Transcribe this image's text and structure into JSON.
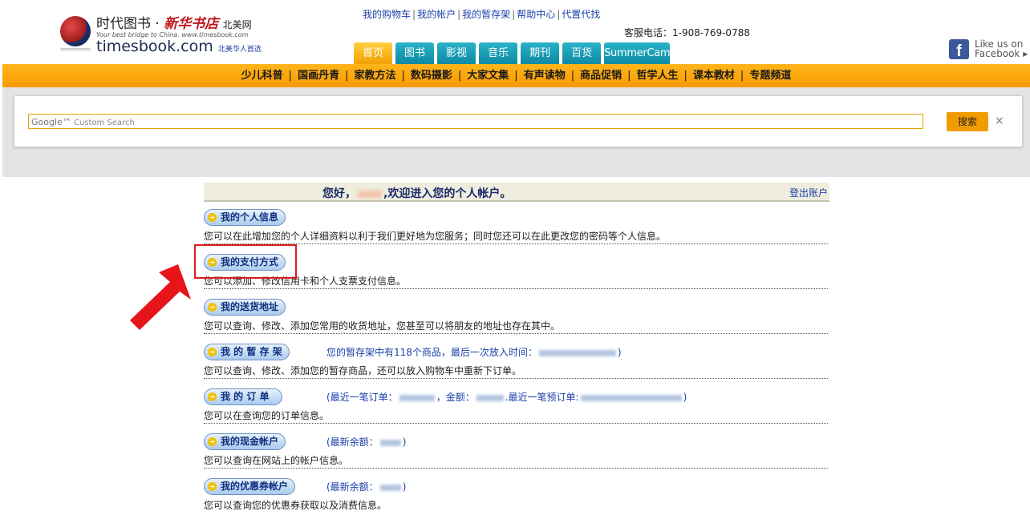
{
  "logo": {
    "name_cn": "时代图书",
    "dot": "·",
    "brand_script": "新华书店",
    "region": "北美网",
    "tagline": "Your best bridge to China. www.timesbook.com",
    "domain": "timesbook.com",
    "slogan": "北美华人首选"
  },
  "top_links": [
    "我的购物车",
    "我的帐户",
    "我的暂存架",
    "帮助中心",
    "代置代找"
  ],
  "phone": "客服电话：1-908-769-0788",
  "tabs": [
    "首页",
    "图书",
    "影视",
    "音乐",
    "期刊",
    "百货",
    "SummerCamp"
  ],
  "facebook": {
    "line1": "Like us on",
    "line2": "Facebook ▸"
  },
  "categories": [
    "少儿科普",
    "国画丹青",
    "家教方法",
    "数码摄影",
    "大家文集",
    "有声读物",
    "商品促销",
    "哲学人生",
    "课本教材",
    "专题频道"
  ],
  "search": {
    "placeholder_brand": "Google™",
    "placeholder": "Custom Search",
    "button": "搜索",
    "close": "×"
  },
  "welcome": {
    "prefix": "您好，",
    "suffix": ",欢迎进入您的个人帐户。",
    "logout": "登出账户"
  },
  "sections": [
    {
      "title": "我的个人信息",
      "extra": "",
      "desc": "您可以在此增加您的个人详细资料以利于我们更好地为您服务；同时您还可以在此更改您的密码等个人信息。"
    },
    {
      "title": "我的支付方式",
      "extra": "",
      "desc": "您可以添加、修改信用卡和个人支票支付信息。"
    },
    {
      "title": "我的送货地址",
      "extra": "",
      "desc": "您可以查询、修改、添加您常用的收货地址，您甚至可以将朋友的地址也存在其中。"
    },
    {
      "title": "我 的 暂 存 架",
      "extra": "您的暂存架中有118个商品，最后一次放入时间：",
      "extra_end": ")",
      "desc": "您可以查询、修改、添加您的暂存商品，还可以放入购物车中重新下订单。"
    },
    {
      "title": "我 的 订 单",
      "extra": "(最近一笔订单：",
      "extra_mid": "，金额：",
      "extra_mid2": ".最近一笔预订单:",
      "extra_end": ")",
      "desc": "您可以在查询您的订单信息。"
    },
    {
      "title": "我的现金帐户",
      "extra": "(最新余额：",
      "extra_end": ")",
      "desc": "您可以查询在网站上的帐户信息。"
    },
    {
      "title": "我的优惠券帐户",
      "extra": "(最新余额：",
      "extra_end": ")",
      "desc": "您可以查询您的优惠券获取以及消费信息。"
    }
  ],
  "colors": {
    "orange_bar": "#f79a00",
    "tab_teal": "#0d8aa3",
    "tab_active": "#f2a100",
    "highlight_red": "#d91c1c",
    "link_blue": "#1a3fa8"
  }
}
